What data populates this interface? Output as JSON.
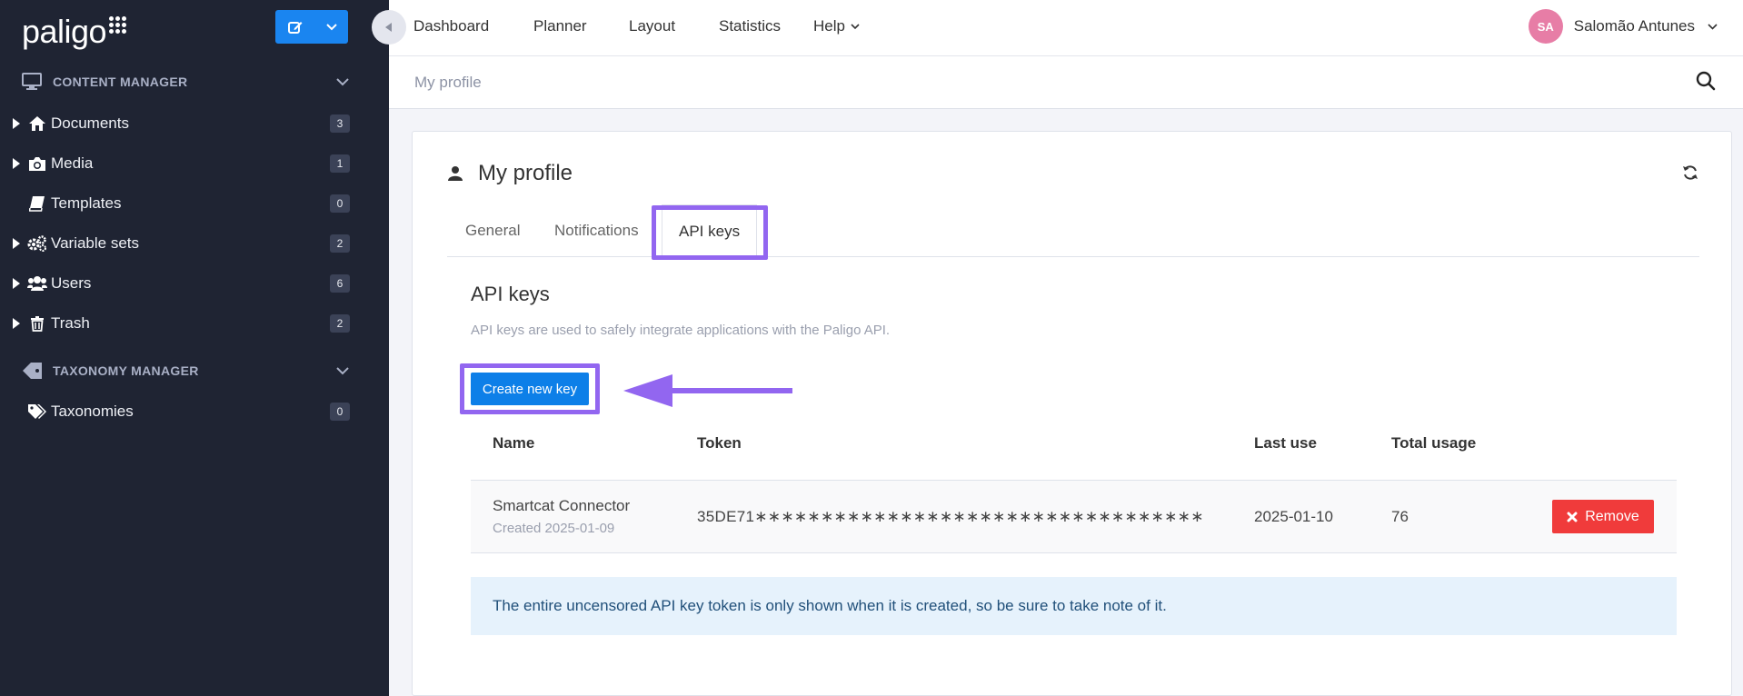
{
  "brand": {
    "logo": "paligo"
  },
  "sidebar": {
    "content_manager": "CONTENT MANAGER",
    "taxonomy_manager": "TAXONOMY MANAGER",
    "items": [
      {
        "label": "Documents",
        "count": "3"
      },
      {
        "label": "Media",
        "count": "1"
      },
      {
        "label": "Templates",
        "count": "0"
      },
      {
        "label": "Variable sets",
        "count": "2"
      },
      {
        "label": "Users",
        "count": "6"
      },
      {
        "label": "Trash",
        "count": "2"
      }
    ],
    "taxonomy_items": [
      {
        "label": "Taxonomies",
        "count": "0"
      }
    ]
  },
  "topnav": {
    "items": [
      "Dashboard",
      "Planner",
      "Layout",
      "Statistics",
      "Help"
    ],
    "user": {
      "initials": "SA",
      "name": "Salomão Antunes"
    }
  },
  "breadcrumb": "My profile",
  "card": {
    "title": "My profile",
    "tabs": [
      "General",
      "Notifications",
      "API keys"
    ],
    "active_tab": "API keys"
  },
  "api_keys": {
    "title": "API keys",
    "description": "API keys are used to safely integrate applications with the Paligo API.",
    "create_label": "Create new key",
    "columns": [
      "Name",
      "Token",
      "Last use",
      "Total usage"
    ],
    "rows": [
      {
        "name": "Smartcat Connector",
        "created": "Created 2025-01-09",
        "token": "35DE71∗∗∗∗∗∗∗∗∗∗∗∗∗∗∗∗∗∗∗∗∗∗∗∗∗∗∗∗∗∗∗∗∗∗",
        "last_use": "2025-01-10",
        "total_usage": "76",
        "remove_label": "Remove"
      }
    ],
    "info": "The entire uncensored API key token is only shown when it is created, so be sure to take note of it."
  },
  "colors": {
    "sidebar_bg": "#1f2433",
    "primary": "#0d7fe8",
    "danger": "#f03b3b",
    "highlight": "#9266f0",
    "info_bg": "#e6f2fc"
  }
}
